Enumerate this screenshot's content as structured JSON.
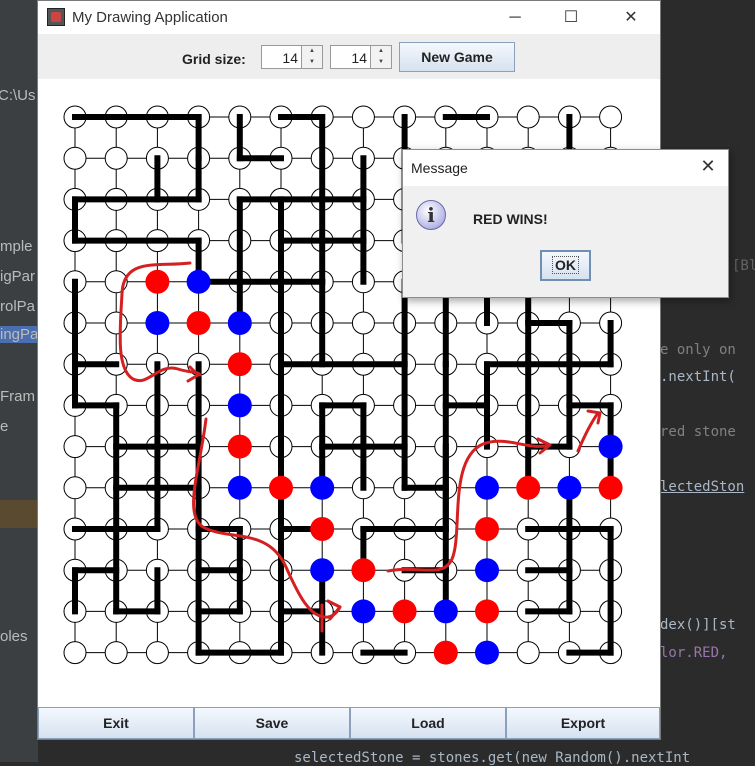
{
  "ide": {
    "left_texts": [
      "C:\\Us",
      "mple",
      "igPar",
      "rolPa",
      "ingPa",
      "Fram",
      "e",
      "oles"
    ],
    "right_texts": [
      "[Bl",
      "e only on",
      ".nextInt(",
      "red stone",
      "lectedSton",
      "dex()][st",
      "lor.RED,"
    ],
    "bottom_text": "selectedStone = stones.get(new Random().nextInt"
  },
  "window": {
    "title": "My Drawing Application",
    "minimize_label": "─",
    "maximize_label": "☐",
    "close_label": "✕"
  },
  "toolbar": {
    "grid_size_label": "Grid size:",
    "rows_value": "14",
    "cols_value": "14",
    "new_game_label": "New Game"
  },
  "board": {
    "rows": 14,
    "cols": 14,
    "colors": {
      "red": "#ff0000",
      "blue": "#0000ff",
      "line": "#000000",
      "annotation": "#d42020"
    },
    "stones": [
      {
        "row": 4,
        "col": 2,
        "color": "red"
      },
      {
        "row": 4,
        "col": 3,
        "color": "blue"
      },
      {
        "row": 5,
        "col": 2,
        "color": "blue"
      },
      {
        "row": 5,
        "col": 3,
        "color": "red"
      },
      {
        "row": 5,
        "col": 4,
        "color": "blue"
      },
      {
        "row": 6,
        "col": 4,
        "color": "red"
      },
      {
        "row": 7,
        "col": 4,
        "color": "blue"
      },
      {
        "row": 8,
        "col": 4,
        "color": "red"
      },
      {
        "row": 8,
        "col": 13,
        "color": "blue"
      },
      {
        "row": 9,
        "col": 4,
        "color": "blue"
      },
      {
        "row": 9,
        "col": 5,
        "color": "red"
      },
      {
        "row": 9,
        "col": 6,
        "color": "blue"
      },
      {
        "row": 9,
        "col": 10,
        "color": "blue"
      },
      {
        "row": 9,
        "col": 11,
        "color": "red"
      },
      {
        "row": 9,
        "col": 12,
        "color": "blue"
      },
      {
        "row": 9,
        "col": 13,
        "color": "red"
      },
      {
        "row": 10,
        "col": 6,
        "color": "red"
      },
      {
        "row": 10,
        "col": 10,
        "color": "red"
      },
      {
        "row": 11,
        "col": 6,
        "color": "blue"
      },
      {
        "row": 11,
        "col": 7,
        "color": "red"
      },
      {
        "row": 11,
        "col": 10,
        "color": "blue"
      },
      {
        "row": 12,
        "col": 7,
        "color": "blue"
      },
      {
        "row": 12,
        "col": 8,
        "color": "red"
      },
      {
        "row": 12,
        "col": 9,
        "color": "blue"
      },
      {
        "row": 12,
        "col": 10,
        "color": "red"
      },
      {
        "row": 13,
        "col": 9,
        "color": "red"
      },
      {
        "row": 13,
        "col": 10,
        "color": "blue"
      }
    ],
    "h_segments": [
      [
        0,
        0,
        3
      ],
      [
        0,
        5,
        6
      ],
      [
        0,
        9,
        10
      ],
      [
        1,
        3,
        3
      ],
      [
        1,
        4,
        5
      ],
      [
        2,
        0,
        3
      ],
      [
        2,
        4,
        7
      ],
      [
        3,
        0,
        3
      ],
      [
        3,
        5,
        7
      ],
      [
        4,
        3,
        6
      ],
      [
        5,
        11,
        12
      ],
      [
        6,
        0,
        1
      ],
      [
        6,
        5,
        8
      ],
      [
        6,
        10,
        13
      ],
      [
        7,
        0,
        1
      ],
      [
        7,
        6,
        7
      ],
      [
        7,
        9,
        10
      ],
      [
        7,
        12,
        13
      ],
      [
        8,
        1,
        3
      ],
      [
        8,
        6,
        8
      ],
      [
        8,
        11,
        12
      ],
      [
        9,
        1,
        3
      ],
      [
        9,
        8,
        9
      ],
      [
        10,
        0,
        2
      ],
      [
        10,
        3,
        4
      ],
      [
        10,
        5,
        6
      ],
      [
        10,
        7,
        9
      ],
      [
        10,
        11,
        13
      ],
      [
        11,
        0,
        1
      ],
      [
        11,
        3,
        4
      ],
      [
        11,
        8,
        9
      ],
      [
        11,
        11,
        12
      ],
      [
        12,
        1,
        2
      ],
      [
        12,
        3,
        4
      ],
      [
        12,
        5,
        6
      ],
      [
        12,
        11,
        12
      ],
      [
        13,
        3,
        5
      ],
      [
        13,
        7,
        8
      ],
      [
        13,
        12,
        13
      ]
    ],
    "v_segments": [
      [
        3,
        0,
        2
      ],
      [
        4,
        0,
        1
      ],
      [
        6,
        0,
        4
      ],
      [
        8,
        0,
        3
      ],
      [
        12,
        0,
        1
      ],
      [
        2,
        1,
        2
      ],
      [
        7,
        1,
        4
      ],
      [
        0,
        2,
        3
      ],
      [
        4,
        2,
        5
      ],
      [
        5,
        2,
        4
      ],
      [
        3,
        3,
        4
      ],
      [
        9,
        3,
        6
      ],
      [
        10,
        3,
        5
      ],
      [
        0,
        4,
        7
      ],
      [
        5,
        4,
        13
      ],
      [
        6,
        4,
        6
      ],
      [
        8,
        4,
        6
      ],
      [
        11,
        4,
        9
      ],
      [
        12,
        5,
        8
      ],
      [
        13,
        5,
        6
      ],
      [
        2,
        6,
        8
      ],
      [
        3,
        6,
        8
      ],
      [
        8,
        6,
        9
      ],
      [
        9,
        6,
        11
      ],
      [
        10,
        6,
        8
      ],
      [
        1,
        7,
        12
      ],
      [
        6,
        7,
        9
      ],
      [
        7,
        7,
        9
      ],
      [
        13,
        7,
        9
      ],
      [
        2,
        8,
        10
      ],
      [
        3,
        8,
        13
      ],
      [
        9,
        8,
        10
      ],
      [
        12,
        9,
        12
      ],
      [
        4,
        10,
        12
      ],
      [
        7,
        10,
        11
      ],
      [
        13,
        10,
        13
      ],
      [
        0,
        11,
        12
      ],
      [
        2,
        11,
        12
      ],
      [
        6,
        11,
        13
      ],
      [
        9,
        11,
        12
      ]
    ]
  },
  "buttons": {
    "exit": "Exit",
    "save": "Save",
    "load": "Load",
    "export": "Export"
  },
  "dialog": {
    "title": "Message",
    "close_label": "✕",
    "message": "RED WINS!",
    "ok_label": "OK"
  }
}
